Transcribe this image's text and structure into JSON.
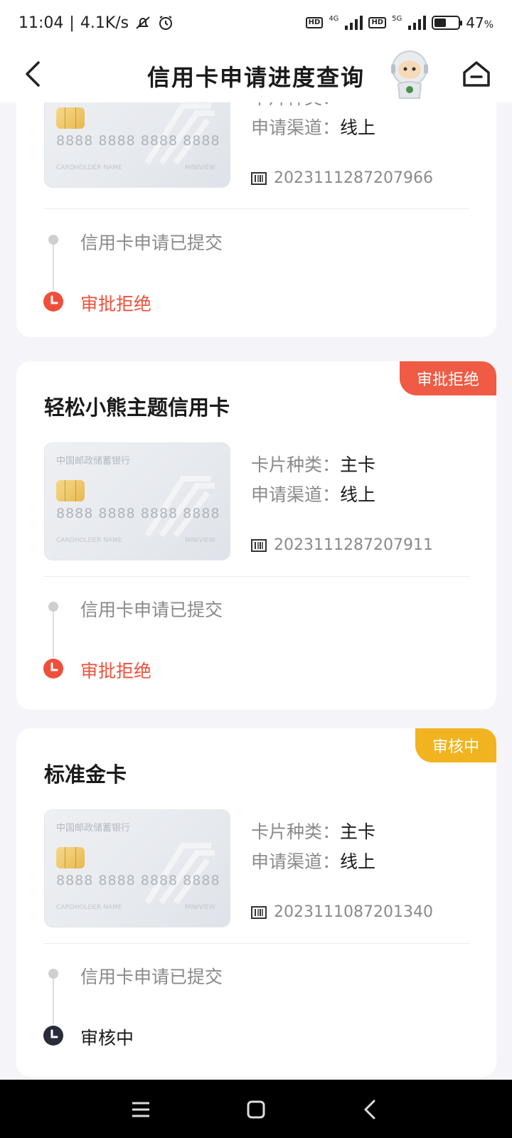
{
  "status_bar": {
    "time": "11:04",
    "speed": "4.1K/s",
    "battery_text": "47",
    "battery_unit": "%",
    "battery_level": 0.47,
    "hd1": "HD",
    "net1": "4G",
    "hd2": "HD",
    "net2": "5G"
  },
  "header": {
    "title": "信用卡申请进度查询"
  },
  "card_face": {
    "bank_name": "中国邮政储蓄银行",
    "number": "8888 8888 8888 8888",
    "holder": "CARDHOLDER NAME",
    "mark": "MINIVIEW"
  },
  "labels": {
    "card_type": "卡片种类：",
    "channel": "申请渠道："
  },
  "applications": [
    {
      "channel_value": "线上",
      "serial": "2023111287207966",
      "steps": [
        {
          "text": "信用卡申请已提交"
        },
        {
          "text": "审批拒绝"
        }
      ]
    },
    {
      "tag": "审批拒绝",
      "name": "轻松小熊主题信用卡",
      "card_type_value": "主卡",
      "channel_value": "线上",
      "serial": "2023111287207911",
      "steps": [
        {
          "text": "信用卡申请已提交"
        },
        {
          "text": "审批拒绝"
        }
      ]
    },
    {
      "tag": "审核中",
      "name": "标准金卡",
      "card_type_value": "主卡",
      "channel_value": "线上",
      "serial": "2023111087201340",
      "steps": [
        {
          "text": "信用卡申请已提交"
        },
        {
          "text": "审核中"
        }
      ]
    }
  ],
  "colors": {
    "reject": "#ef5b44",
    "pending": "#f1b420",
    "dark": "#2a2c3a"
  }
}
